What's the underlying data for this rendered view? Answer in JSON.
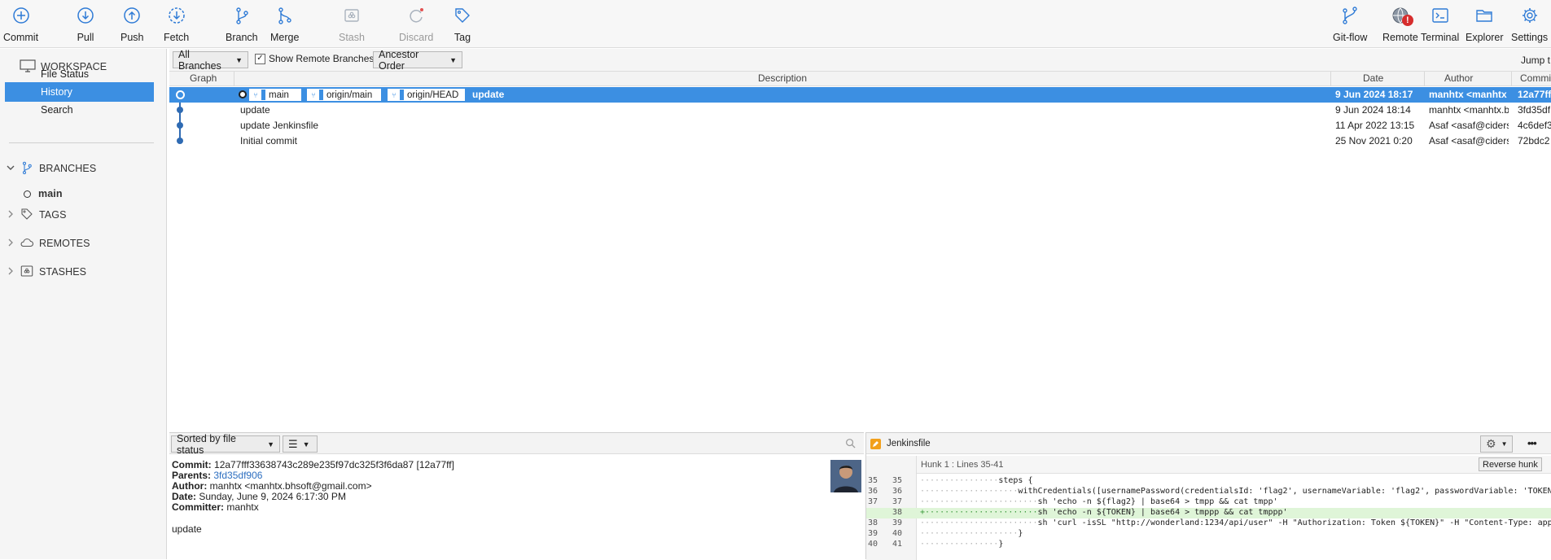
{
  "toolbar": {
    "left": [
      {
        "label": "Commit",
        "icon": "plus-circle-icon"
      },
      {
        "label": "Pull",
        "icon": "arrow-down-circle-icon"
      },
      {
        "label": "Push",
        "icon": "arrow-up-circle-icon"
      },
      {
        "label": "Fetch",
        "icon": "arrow-down-dashed-circle-icon"
      },
      {
        "label": "Branch",
        "icon": "branch-icon"
      },
      {
        "label": "Merge",
        "icon": "merge-icon"
      },
      {
        "label": "Stash",
        "icon": "stash-icon"
      },
      {
        "label": "Discard",
        "icon": "discard-icon"
      },
      {
        "label": "Tag",
        "icon": "tag-icon"
      }
    ],
    "right": [
      {
        "label": "Git-flow",
        "icon": "git-flow-icon"
      },
      {
        "label": "Remote",
        "icon": "globe-icon"
      },
      {
        "label": "Terminal",
        "icon": "terminal-icon"
      },
      {
        "label": "Explorer",
        "icon": "folder-icon"
      },
      {
        "label": "Settings",
        "icon": "gear-icon"
      }
    ],
    "remote_alert": "!"
  },
  "sidebar": {
    "workspace": "WORKSPACE",
    "items": [
      {
        "label": "File Status"
      },
      {
        "label": "History"
      },
      {
        "label": "Search"
      }
    ],
    "branches": "BRANCHES",
    "branch_main": "main",
    "tags": "TAGS",
    "remotes": "REMOTES",
    "stashes": "STASHES"
  },
  "filter": {
    "branches": "All Branches",
    "show_remote": "Show Remote Branches",
    "order": "Ancestor Order",
    "jump": "Jump t"
  },
  "table": {
    "headers": {
      "graph": "Graph",
      "description": "Description",
      "date": "Date",
      "author": "Author",
      "commit": "Commi"
    },
    "badges": [
      "main",
      "origin/main",
      "origin/HEAD"
    ],
    "rows": [
      {
        "desc": "update",
        "date": "9 Jun 2024 18:17",
        "author": "manhtx <manhtx",
        "commit": "12a77ff"
      },
      {
        "desc": "update",
        "date": "9 Jun 2024 18:14",
        "author": "manhtx <manhtx.b",
        "commit": "3fd35df"
      },
      {
        "desc": "update Jenkinsfile",
        "date": "11 Apr 2022 13:15",
        "author": "Asaf <asaf@ciders",
        "commit": "4c6def3"
      },
      {
        "desc": "Initial commit",
        "date": "25 Nov 2021 0:20",
        "author": "Asaf <asaf@ciders",
        "commit": "72bdc2"
      }
    ]
  },
  "details": {
    "sort": "Sorted by file status",
    "commit_label": "Commit:",
    "commit_val": "12a77fff33638743c289e235f97dc325f3f6da87 [12a77ff]",
    "parents_label": "Parents:",
    "parents_val": "3fd35df906",
    "author_label": "Author:",
    "author_val": "manhtx <manhtx.bhsoft@gmail.com>",
    "date_label": "Date:",
    "date_val": "Sunday, June 9, 2024 6:17:30 PM",
    "committer_label": "Committer:",
    "committer_val": "manhtx",
    "message": "update"
  },
  "diff": {
    "file": "Jenkinsfile",
    "hunk": "Hunk 1 : Lines 35-41",
    "reverse": "Reverse hunk",
    "more": "•••",
    "lines": [
      {
        "n1": "35",
        "n2": "35",
        "ws": "················",
        "code": "steps {",
        "add": false
      },
      {
        "n1": "36",
        "n2": "36",
        "ws": "····················",
        "code": "withCredentials([usernamePassword(credentialsId: 'flag2', usernameVariable: 'flag2', passwordVariable: 'TOKEN",
        "add": false
      },
      {
        "n1": "37",
        "n2": "37",
        "ws": "························",
        "code": "sh 'echo -n ${flag2} | base64 > tmpp && cat tmpp'",
        "add": false
      },
      {
        "n1": "",
        "n2": "38",
        "ws": "+·······················",
        "code": "sh 'echo -n ${TOKEN} | base64 > tmppp && cat tmppp'",
        "add": true
      },
      {
        "n1": "38",
        "n2": "39",
        "ws": "························",
        "code": "sh 'curl -isSL \"http://wonderland:1234/api/user\" -H \"Authorization: Token ${TOKEN}\" -H \"Content-Type: app",
        "add": false
      },
      {
        "n1": "39",
        "n2": "40",
        "ws": "····················",
        "code": "}",
        "add": false
      },
      {
        "n1": "40",
        "n2": "41",
        "ws": "················",
        "code": "}",
        "add": false
      }
    ]
  }
}
